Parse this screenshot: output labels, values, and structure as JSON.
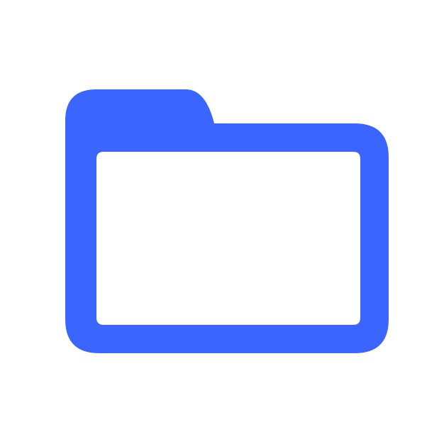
{
  "icon": {
    "name": "folder-icon",
    "color": "#3A66FF",
    "background": "#FFFFFF"
  }
}
